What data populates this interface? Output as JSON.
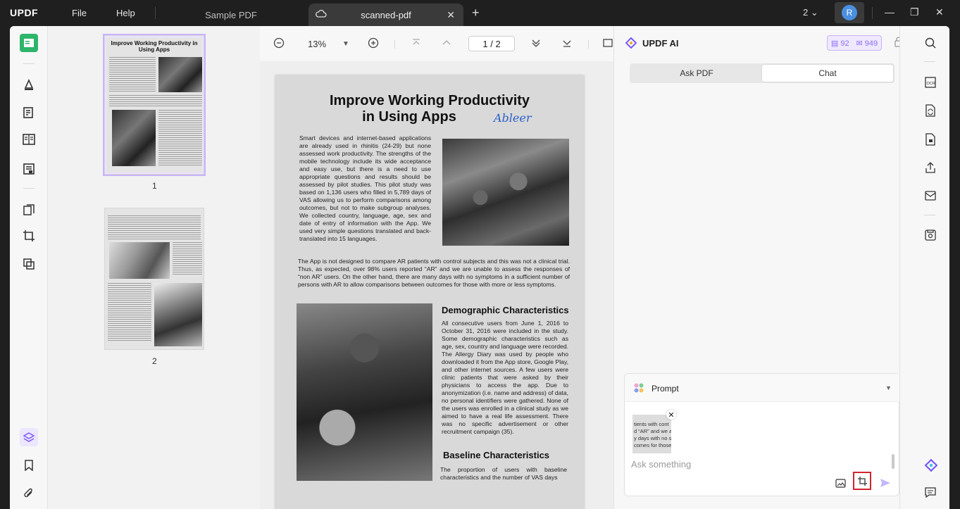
{
  "app": {
    "logo": "UPDF"
  },
  "menu": {
    "file": "File",
    "help": "Help"
  },
  "tabs": [
    {
      "label": "Sample PDF",
      "active": false
    },
    {
      "label": "scanned-pdf",
      "active": true
    }
  ],
  "window": {
    "count": "2",
    "avatar_initial": "R"
  },
  "left_rail": {
    "items": [
      "reader-icon",
      "comment-icon",
      "edit-icon",
      "page-icon",
      "form-icon",
      "organize-icon",
      "crop-icon",
      "compare-icon"
    ],
    "bottom": [
      "layers-icon",
      "bookmark-icon",
      "attachment-icon"
    ]
  },
  "thumbnails": [
    {
      "number": "1",
      "title": "Improve Working Productivity in Using Apps"
    },
    {
      "number": "2"
    }
  ],
  "toolbar": {
    "zoom": "13%",
    "page_current": "1",
    "page_separator": "/",
    "page_total": "2"
  },
  "document": {
    "title_line1": "Improve Working Productivity",
    "title_line2": "in Using Apps",
    "signature": "Ableer",
    "intro": "Smart devices and internet-based applications are already used in rhinitis (24-29) but none assessed work productivity. The strengths of the mobile technology include its wide acceptance and easy use, but there is a need to use appropriate questions and results should be assessed by pilot studies. This pilot study was based on 1,136 users who filled in 5,789 days of VAS allowing us to perform comparisons among outcomes, but not to make subgroup analyses. We collected country, language, age, sex and date of entry of information with the App. We used very simple questions translated and back-translated into 15 languages.",
    "body": "The App is not designed to compare AR patients with control subjects and this was not a clinical trial. Thus, as expected, over 98% users reported “AR” and we are unable to assess the responses of “non AR” users. On the other hand, there are many days with no symptoms in a sufficient number of persons with AR to allow comparisons between outcomes for those with more or less symptoms.",
    "demo_heading": "Demographic Characteristics",
    "demo_text": "All consecutive users from June 1, 2016 to October 31, 2016 were included in the study. Some demographic characteristics such as age, sex, country and language were recorded. The Allergy Diary was used by people who downloaded it from the App store, Google Play, and other internet sources. A few users were clinic patients that were asked by their physicians to access the app. Due to anonymization (i.e. name and address) of data, no personal identifiers were gathered. None of the users was enrolled in a clinical study as we aimed to have a real life assessment. There was no specific advertisement or other recruitment campaign (35).",
    "baseline_heading": "Baseline Characteristics",
    "baseline_text": "The proportion of users with baseline characteristics and the number of VAS days"
  },
  "ai_panel": {
    "title": "UPDF AI",
    "credit_a": "92",
    "credit_b": "949",
    "tab_ask_pdf": "Ask PDF",
    "tab_chat": "Chat",
    "prompt_label": "Prompt",
    "attachment_preview_lines": [
      "tients with cont",
      "d “AR” and we a",
      "y days with no s",
      "comes for those"
    ],
    "input_placeholder": "Ask something"
  },
  "colors": {
    "accent": "#7a5af8",
    "highlight_box": "#d1242f"
  }
}
